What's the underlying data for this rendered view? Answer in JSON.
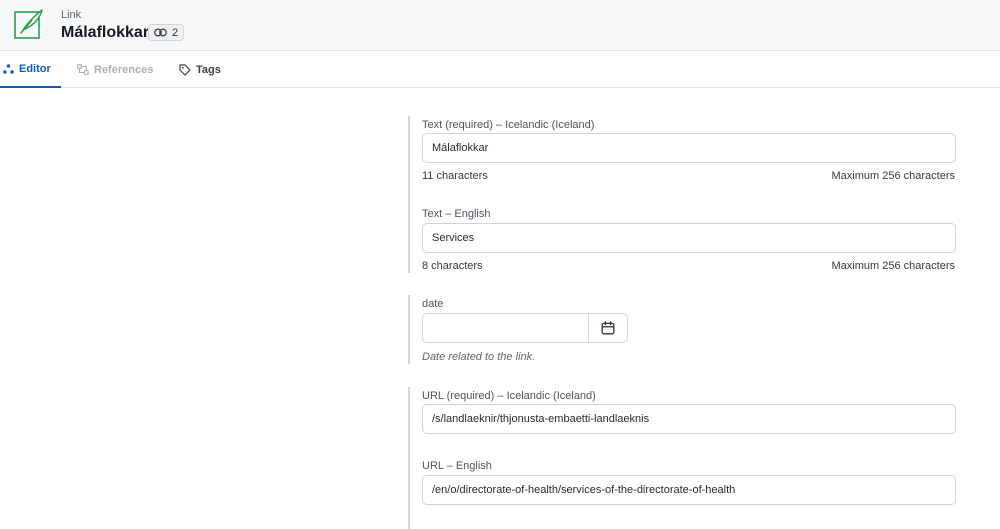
{
  "header": {
    "content_type": "Link",
    "title": "Málaflokkar",
    "reference_count": "2"
  },
  "tabs": [
    {
      "label": "Editor",
      "state": "active"
    },
    {
      "label": "References",
      "state": "disabled"
    },
    {
      "label": "Tags",
      "state": "normal"
    }
  ],
  "fields": {
    "text_is": {
      "label": "Text (required) – Icelandic (Iceland)",
      "value": "Málaflokkar",
      "count": "11 characters",
      "max": "Maximum 256 characters"
    },
    "text_en": {
      "label": "Text – English",
      "value": "Services",
      "count": "8 characters",
      "max": "Maximum 256 characters"
    },
    "date": {
      "label": "date",
      "value": "",
      "help": "Date related to the link."
    },
    "url_is": {
      "label": "URL (required) – Icelandic (Iceland)",
      "value": "/s/landlaeknir/thjonusta-embaetti-landlaeknis"
    },
    "url_en": {
      "label": "URL – English",
      "value": "/en/o/directorate-of-health/services-of-the-directorate-of-health"
    }
  },
  "colors": {
    "accent": "#0b5cc1",
    "icon_green": "#2e9e4f",
    "header_bg": "#f7f8f9"
  },
  "icons": {
    "entry": "feather-icon",
    "reference": "link-icon",
    "editor": "editor-nodes-icon",
    "references": "references-icon",
    "tags": "tag-icon",
    "calendar": "calendar-icon"
  }
}
